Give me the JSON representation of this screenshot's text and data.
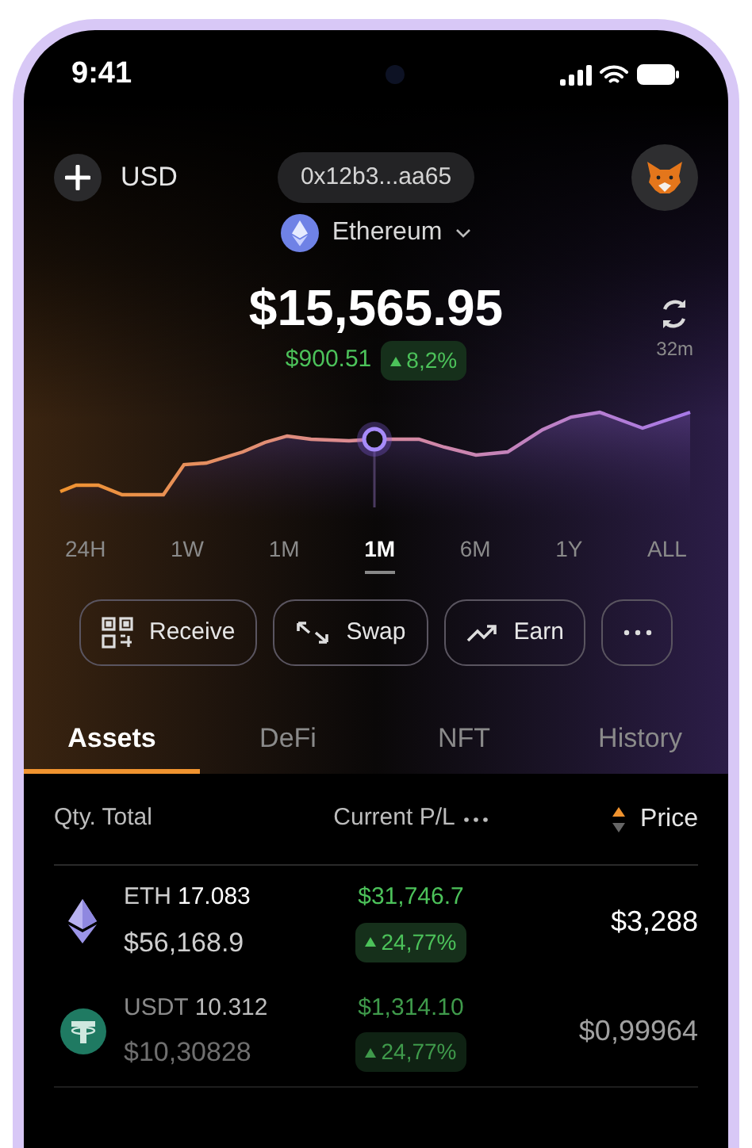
{
  "status_bar": {
    "time": "9:41"
  },
  "header": {
    "currency": "USD",
    "address": "0x12b3...aa65",
    "network": "Ethereum"
  },
  "balance": {
    "total": "$15,565.95",
    "change": "$900.51",
    "change_percent": "8,2%",
    "refresh_age": "32m"
  },
  "periods": [
    {
      "label": "24H",
      "selected": false
    },
    {
      "label": "1W",
      "selected": false
    },
    {
      "label": "1M",
      "selected": false
    },
    {
      "label": "1M",
      "selected": true
    },
    {
      "label": "6M",
      "selected": false
    },
    {
      "label": "1Y",
      "selected": false
    },
    {
      "label": "ALL",
      "selected": false
    }
  ],
  "actions": [
    {
      "kind": "receive",
      "label": "Receive"
    },
    {
      "kind": "swap",
      "label": "Swap"
    },
    {
      "kind": "earn",
      "label": "Earn"
    },
    {
      "kind": "more"
    }
  ],
  "tabs": [
    {
      "label": "Assets",
      "selected": true
    },
    {
      "label": "DeFi",
      "selected": false
    },
    {
      "label": "NFT",
      "selected": false
    },
    {
      "label": "History",
      "selected": false
    }
  ],
  "table": {
    "columns": [
      "Qty. Total",
      "Current P/L",
      "Price"
    ],
    "rows": [
      {
        "kind": "eth",
        "symbol": "ETH",
        "quantity": "17.083",
        "value": "$56,168.9",
        "pl": "$31,746.7",
        "pl_percent": "24,77%",
        "price": "$3,288"
      },
      {
        "kind": "usdt",
        "symbol": "USDT",
        "quantity": "10.312",
        "value": "$10,30828",
        "pl": "$1,314.10",
        "pl_percent": "24,77%",
        "price": "$0,99964"
      }
    ]
  }
}
